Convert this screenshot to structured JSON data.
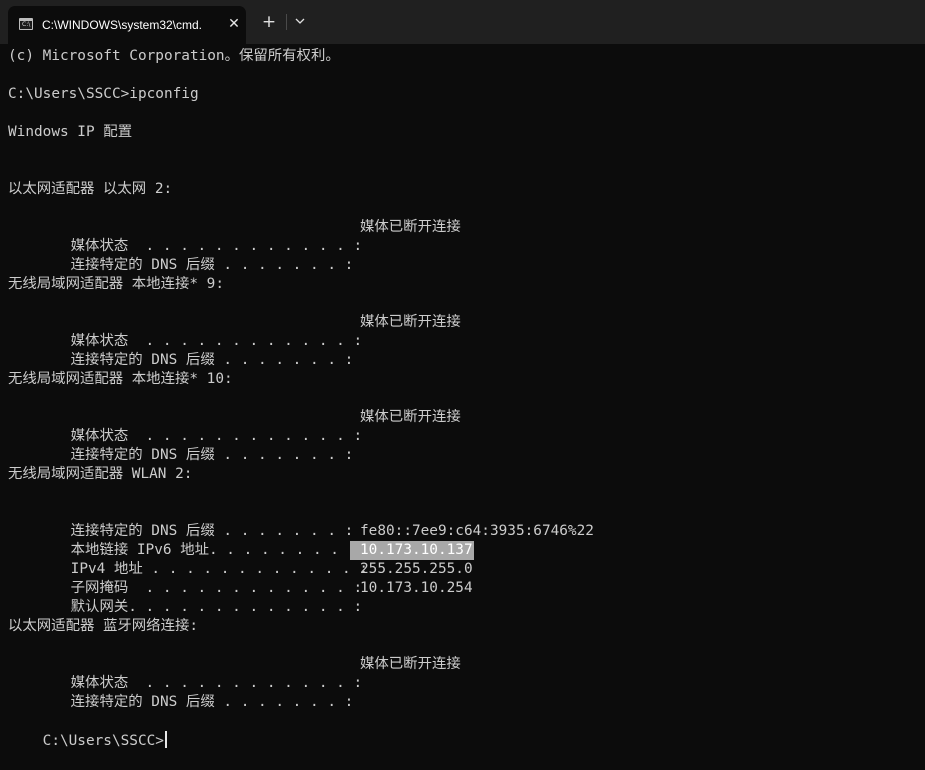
{
  "window": {
    "tab_title": "C:\\WINDOWS\\system32\\cmd.",
    "tab_close": "✕",
    "new_tab": "+",
    "tab_icon_text": "C:\\"
  },
  "console": {
    "copyright": "(c) Microsoft Corporation。保留所有权利。",
    "prompt_command": "C:\\Users\\SSCC>ipconfig",
    "heading": "Windows IP 配置",
    "adapters": [
      {
        "title": "以太网适配器 以太网 2:",
        "rows": [
          {
            "label": "媒体状态  . . . . . . . . . . . . :",
            "value": "媒体已断开连接"
          },
          {
            "label": "连接特定的 DNS 后缀 . . . . . . . :",
            "value": ""
          }
        ]
      },
      {
        "title": "无线局域网适配器 本地连接* 9:",
        "rows": [
          {
            "label": "媒体状态  . . . . . . . . . . . . :",
            "value": "媒体已断开连接"
          },
          {
            "label": "连接特定的 DNS 后缀 . . . . . . . :",
            "value": ""
          }
        ]
      },
      {
        "title": "无线局域网适配器 本地连接* 10:",
        "rows": [
          {
            "label": "媒体状态  . . . . . . . . . . . . :",
            "value": "媒体已断开连接"
          },
          {
            "label": "连接特定的 DNS 后缀 . . . . . . . :",
            "value": ""
          }
        ]
      },
      {
        "title": "无线局域网适配器 WLAN 2:",
        "rows": [
          {
            "label": "连接特定的 DNS 后缀 . . . . . . . :",
            "value": ""
          },
          {
            "label": "本地链接 IPv6 地址. . . . . . . . :",
            "value": "fe80::7ee9:c64:3935:6746%22"
          },
          {
            "label": "IPv4 地址 . . . . . . . . . . . . :",
            "value": "10.173.10.137"
          },
          {
            "label": "子网掩码  . . . . . . . . . . . . :",
            "value": "255.255.255.0"
          },
          {
            "label": "默认网关. . . . . . . . . . . . . :",
            "value": "10.173.10.254"
          }
        ]
      },
      {
        "title": "以太网适配器 蓝牙网络连接:",
        "rows": [
          {
            "label": "媒体状态  . . . . . . . . . . . . :",
            "value": "媒体已断开连接"
          },
          {
            "label": "连接特定的 DNS 后缀 . . . . . . . :",
            "value": ""
          }
        ]
      }
    ],
    "final_prompt": "C:\\Users\\SSCC>"
  },
  "colors": {
    "background": "#0c0c0c",
    "titlebar": "#202020",
    "text": "#cccccc",
    "selection": "#a8a8a8"
  }
}
